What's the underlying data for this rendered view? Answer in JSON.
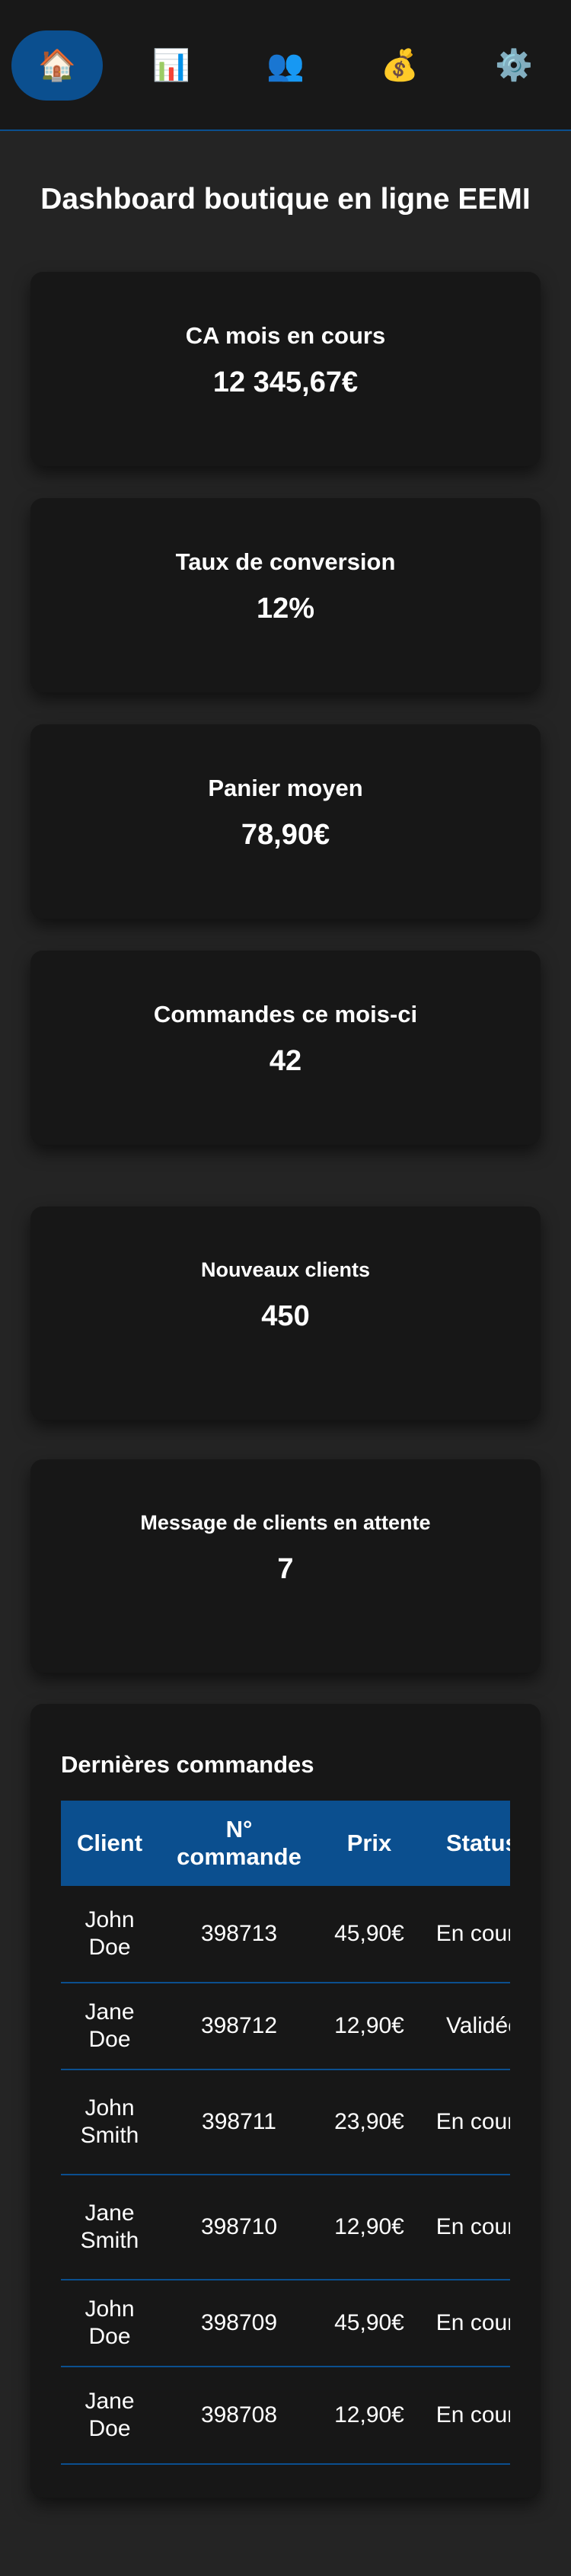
{
  "nav": {
    "items": [
      {
        "icon": "🏠",
        "icon_name": "home-icon",
        "active": true
      },
      {
        "icon": "📊",
        "icon_name": "bar-chart-icon",
        "active": false
      },
      {
        "icon": "👥",
        "icon_name": "users-icon",
        "active": false
      },
      {
        "icon": "💰",
        "icon_name": "money-bag-icon",
        "active": false
      },
      {
        "icon": "⚙️",
        "icon_name": "gear-icon",
        "active": false
      }
    ]
  },
  "page": {
    "title": "Dashboard boutique en ligne EEMI"
  },
  "stats": [
    {
      "label": "CA mois en cours",
      "value": "12 345,67€"
    },
    {
      "label": "Taux de conversion",
      "value": "12%"
    },
    {
      "label": "Panier moyen",
      "value": "78,90€"
    },
    {
      "label": "Commandes ce mois-ci",
      "value": "42"
    },
    {
      "label": "Nouveaux clients",
      "value": "450"
    },
    {
      "label": "Message de clients en attente",
      "value": "7"
    }
  ],
  "orders": {
    "title": "Dernières commandes",
    "columns": [
      "Client",
      "N° commande",
      "Prix",
      "Status"
    ],
    "rows": [
      {
        "client": "John Doe",
        "number": "398713",
        "price": "45,90€",
        "status": "En cours"
      },
      {
        "client": "Jane Doe",
        "number": "398712",
        "price": "12,90€",
        "status": "Validée"
      },
      {
        "client": "John Smith",
        "number": "398711",
        "price": "23,90€",
        "status": "En cours"
      },
      {
        "client": "Jane Smith",
        "number": "398710",
        "price": "12,90€",
        "status": "En cours"
      },
      {
        "client": "John Doe",
        "number": "398709",
        "price": "45,90€",
        "status": "En cours"
      },
      {
        "client": "Jane Doe",
        "number": "398708",
        "price": "12,90€",
        "status": "En cours"
      }
    ]
  },
  "colors": {
    "accent": "#0b4f8f",
    "background": "#242424",
    "card": "#171717",
    "nav": "#181818"
  }
}
